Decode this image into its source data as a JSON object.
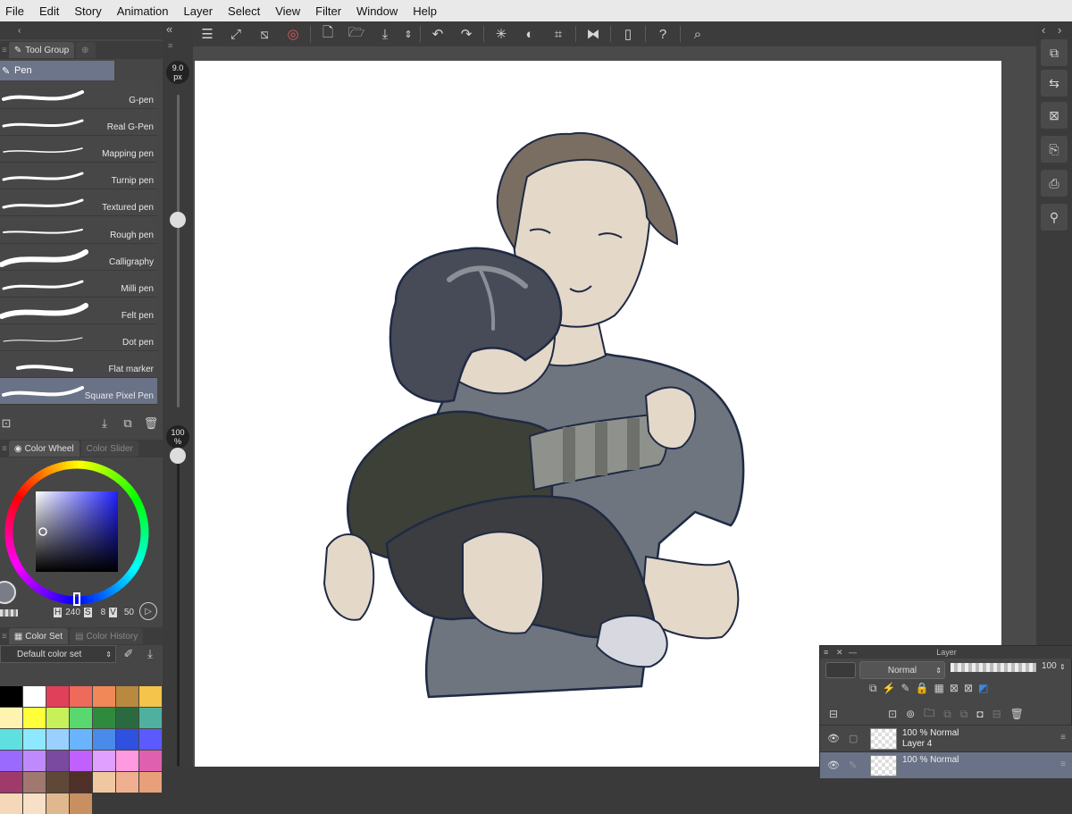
{
  "menu": [
    "File",
    "Edit",
    "Story",
    "Animation",
    "Layer",
    "Select",
    "View",
    "Filter",
    "Window",
    "Help"
  ],
  "tool_panel": {
    "tab_label": "Tool Group",
    "group_title": "Pen",
    "brushes": [
      {
        "name": "G-pen"
      },
      {
        "name": "Real G-Pen"
      },
      {
        "name": "Mapping pen"
      },
      {
        "name": "Turnip pen"
      },
      {
        "name": "Textured pen"
      },
      {
        "name": "Rough pen"
      },
      {
        "name": "Calligraphy"
      },
      {
        "name": "Milli pen"
      },
      {
        "name": "Felt pen"
      },
      {
        "name": "Dot pen"
      },
      {
        "name": "Flat marker"
      },
      {
        "name": "Square Pixel Pen"
      }
    ],
    "selected_brush": "Square Pixel Pen"
  },
  "size_slider": {
    "value": "9.0",
    "unit": "px",
    "level": 0.6
  },
  "opacity_slider": {
    "value": "100",
    "unit": "%",
    "level": 1.0
  },
  "color_panel": {
    "tabs": [
      "Color Wheel",
      "Color Slider"
    ],
    "h_label": "H",
    "h_value": "240",
    "s_label": "S",
    "s_value": "8",
    "v_label": "V",
    "v_value": "50"
  },
  "color_set_panel": {
    "tabs": [
      "Color Set",
      "Color History"
    ],
    "selected_set": "Default color set",
    "swatches": [
      "#000000",
      "#ffffff",
      "#e0405a",
      "#ee6a5a",
      "#f08858",
      "#b8893e",
      "#f5c44a",
      "#fff3b0",
      "#ffff3a",
      "#c8f05a",
      "#5ad870",
      "#2f8a3e",
      "#2a6a40",
      "#4fb0a0",
      "#5ee0e0",
      "#8ee8ff",
      "#9ad0ff",
      "#6ab4ff",
      "#4a8ae8",
      "#3050e0",
      "#5a5aff",
      "#9a6aff",
      "#c08aff",
      "#7a4aa0",
      "#c060ff",
      "#e0a0ff",
      "#ff9ae0",
      "#e060b0",
      "#a03a6a",
      "#a07870",
      "#604838",
      "#503028",
      "#f0c8a0",
      "#f0b090",
      "#e8a07a",
      "#f5d8b8",
      "#f8e0c8",
      "#e0b890",
      "#c89060"
    ]
  },
  "layer_panel": {
    "title": "Layer",
    "blend_mode": "Normal",
    "opacity": "100",
    "layers": [
      {
        "opacity": "100 %",
        "mode": "Normal",
        "name": "Layer 4"
      },
      {
        "opacity": "100 %",
        "mode": "Normal",
        "name": ""
      }
    ]
  }
}
